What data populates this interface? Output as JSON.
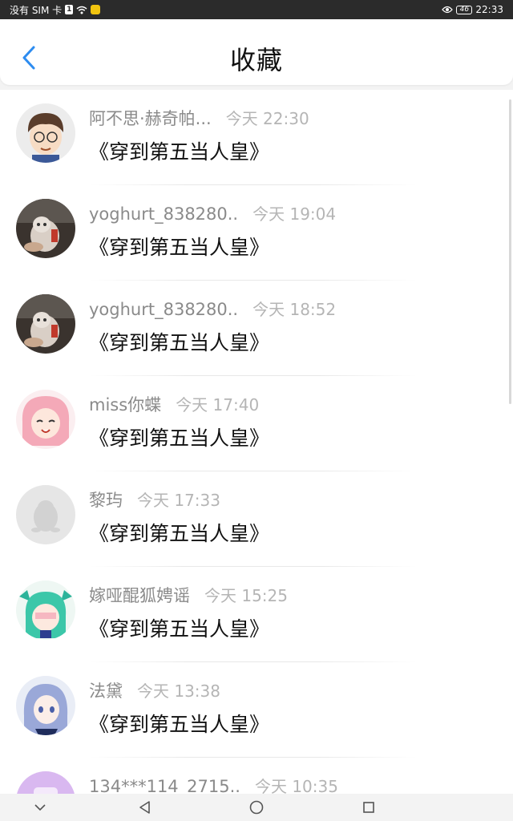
{
  "status_bar": {
    "carrier": "没有 SIM 卡",
    "sim_label": "1",
    "battery": "46",
    "time": "22:33"
  },
  "header": {
    "title": "收藏",
    "back_icon": "chevron-left-icon",
    "accent": "#2d8cf0"
  },
  "items": [
    {
      "username": "阿不思·赫奇帕...",
      "time": "今天 22:30",
      "content": "《穿到第五当人皇》",
      "avatar": "cartoon-boy-avatar"
    },
    {
      "username": "yoghurt_838280..",
      "time": "今天 19:04",
      "content": "《穿到第五当人皇》",
      "avatar": "cat-photo-avatar"
    },
    {
      "username": "yoghurt_838280..",
      "time": "今天 18:52",
      "content": "《穿到第五当人皇》",
      "avatar": "cat-photo-avatar"
    },
    {
      "username": "miss你蝶",
      "time": "今天 17:40",
      "content": "《穿到第五当人皇》",
      "avatar": "pink-anime-avatar"
    },
    {
      "username": "黎玙",
      "time": "今天 17:33",
      "content": "《穿到第五当人皇》",
      "avatar": "default-penguin-avatar"
    },
    {
      "username": "嫁哑醌狐娉谣",
      "time": "今天 15:25",
      "content": "《穿到第五当人皇》",
      "avatar": "green-anime-avatar"
    },
    {
      "username": "法黛",
      "time": "今天 13:38",
      "content": "《穿到第五当人皇》",
      "avatar": "blue-anime-avatar"
    },
    {
      "username": "134***114_2715..",
      "time": "今天 10:35",
      "content": "",
      "avatar": "purple-avatar"
    }
  ],
  "nav_bar": {
    "icons": [
      "chevron-down-icon",
      "back-triangle-icon",
      "home-circle-icon",
      "recents-square-icon"
    ]
  }
}
